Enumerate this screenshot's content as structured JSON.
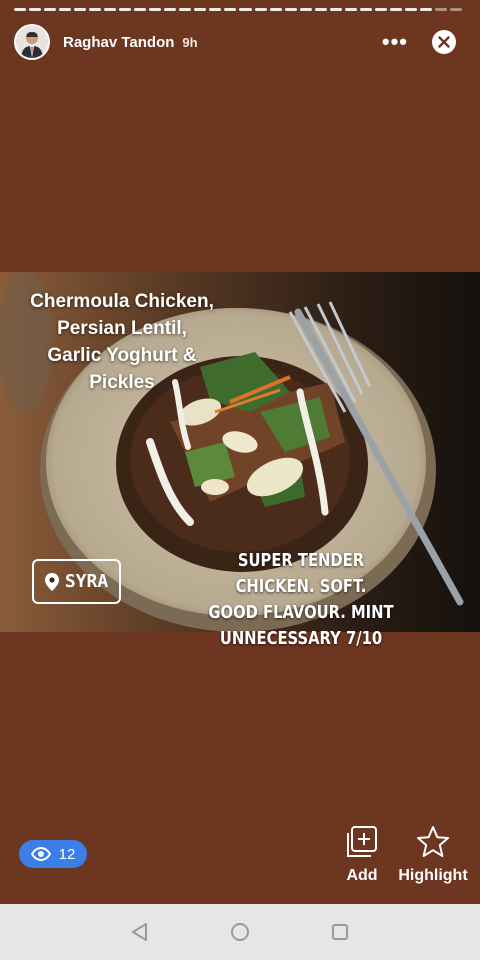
{
  "story": {
    "username": "Raghav Tandon",
    "time_ago": "9h",
    "more_label": "•••",
    "dish_title_lines": [
      "Chermoula Chicken,",
      "Persian Lentil,",
      "Garlic Yoghurt &",
      "Pickles"
    ],
    "location": "SYRA",
    "caption_lines": [
      "SUPER TENDER CHICKEN. SOFT.",
      "GOOD FLAVOUR. MINT",
      "UNNECESSARY 7/10"
    ],
    "view_count": "12"
  },
  "actions": {
    "add_label": "Add",
    "highlight_label": "Highlight"
  },
  "icons": {
    "avatar": "profile-photo",
    "more": "more-dots-icon",
    "close": "close-icon",
    "location": "location-pin-icon",
    "views": "eye-icon",
    "add": "add-to-story-icon",
    "highlight": "star-icon",
    "nav_back": "back-triangle-icon",
    "nav_home": "home-circle-icon",
    "nav_recent": "recent-square-icon"
  },
  "colors": {
    "background": "#6d3620",
    "views_badge": "#3b7ee8",
    "navbar": "#e6e6e6"
  }
}
